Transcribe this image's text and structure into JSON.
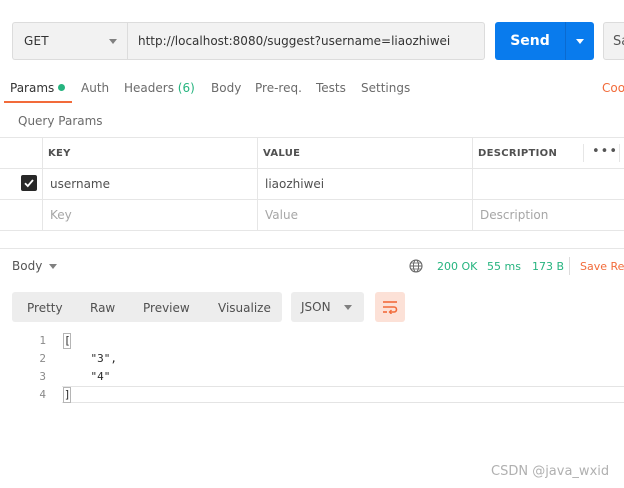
{
  "request": {
    "method": "GET",
    "url": "http://localhost:8080/suggest?username=liaozhiwei",
    "send_label": "Send",
    "save_label": "Sa"
  },
  "tabs": [
    {
      "label": "Params",
      "active": true,
      "dot": true
    },
    {
      "label": "Auth"
    },
    {
      "label": "Headers",
      "count": "(6)"
    },
    {
      "label": "Body"
    },
    {
      "label": "Pre-req."
    },
    {
      "label": "Tests"
    },
    {
      "label": "Settings"
    }
  ],
  "cookies_label": "Coo",
  "query_params": {
    "title": "Query Params",
    "columns": [
      "KEY",
      "VALUE",
      "DESCRIPTION"
    ],
    "rows": [
      {
        "checked": true,
        "key": "username",
        "value": "liaozhiwei",
        "description": ""
      }
    ],
    "placeholder": {
      "key": "Key",
      "value": "Value",
      "description": "Description"
    }
  },
  "response": {
    "body_label": "Body",
    "status": "200 OK",
    "time": "55 ms",
    "size": "173 B",
    "save_label": "Save Re",
    "view_modes": [
      "Pretty",
      "Raw",
      "Preview",
      "Visualize"
    ],
    "format": "JSON",
    "lines": [
      {
        "num": "1",
        "text": "["
      },
      {
        "num": "2",
        "text": "    \"3\","
      },
      {
        "num": "3",
        "text": "    \"4\""
      },
      {
        "num": "4",
        "text": "]"
      }
    ]
  },
  "colors": {
    "accent": "#f26b3a",
    "primary": "#097bed",
    "success": "#26b47f"
  },
  "watermark": "CSDN @java_wxid"
}
